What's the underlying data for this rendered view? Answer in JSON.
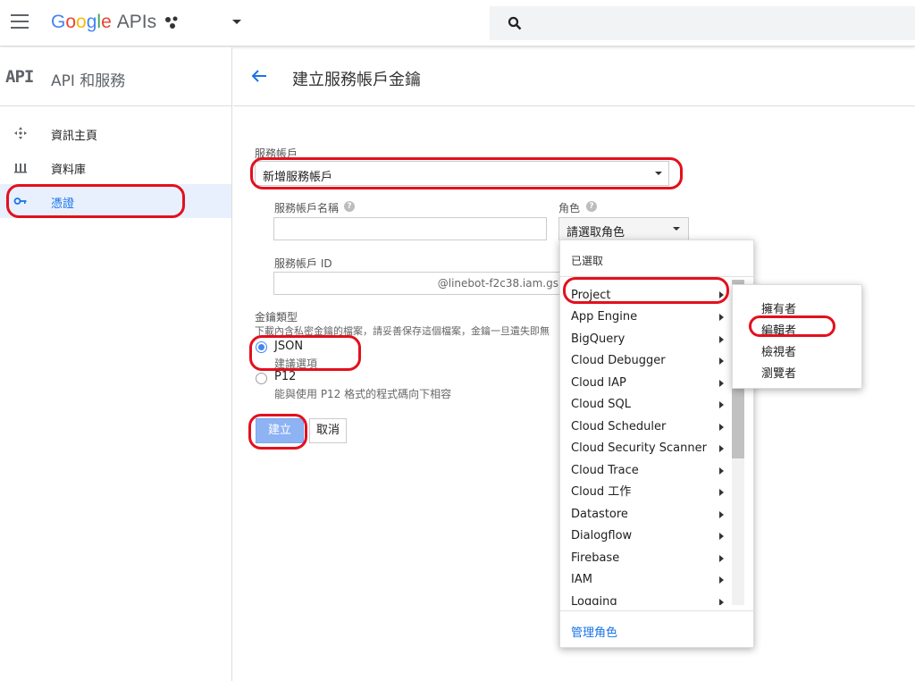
{
  "topbar": {
    "logo_google": [
      "G",
      "o",
      "o",
      "g",
      "l",
      "e"
    ],
    "logo_apis": "APIs",
    "search_icon": "search-icon"
  },
  "sidebar": {
    "badge": "API",
    "title": "API 和服務",
    "items": [
      {
        "label": "資訊主頁",
        "icon": "dashboard-icon",
        "active": false
      },
      {
        "label": "資料庫",
        "icon": "library-icon",
        "active": false
      },
      {
        "label": "憑證",
        "icon": "key-icon",
        "active": true
      }
    ]
  },
  "header": {
    "title": "建立服務帳戶金鑰"
  },
  "form": {
    "service_account_label": "服務帳戶",
    "service_account_value": "新增服務帳戶",
    "name_label": "服務帳戶名稱",
    "name_value": "",
    "role_label": "角色",
    "role_value": "請選取角色",
    "id_label": "服務帳戶 ID",
    "id_suffix": "@linebot-f2c38.iam.gs",
    "key_type_label": "金鑰類型",
    "key_type_desc": "下載內含私密金鑰的檔案，請妥善保存這個檔案，金鑰一旦遺失即無",
    "options": [
      {
        "label": "JSON",
        "sub": "建議選項",
        "selected": true
      },
      {
        "label": "P12",
        "sub": "能與使用 P12 格式的程式碼向下相容",
        "selected": false
      }
    ],
    "create_button": "建立",
    "cancel_button": "取消"
  },
  "role_dropdown": {
    "selected_header": "已選取",
    "items": [
      "Project",
      "App Engine",
      "BigQuery",
      "Cloud Debugger",
      "Cloud IAP",
      "Cloud SQL",
      "Cloud Scheduler",
      "Cloud Security Scanner",
      "Cloud Trace",
      "Cloud 工作",
      "Datastore",
      "Dialogflow",
      "Firebase",
      "IAM",
      "Logging"
    ],
    "manage_roles": "管理角色"
  },
  "project_submenu": {
    "items": [
      "擁有者",
      "編輯者",
      "檢視者",
      "瀏覽者"
    ]
  },
  "colors": {
    "accent": "#1a73e8",
    "highlight": "#e3101d",
    "sidebar_active_bg": "#e8f0fe",
    "create_button_bg": "#8eb3f3"
  }
}
